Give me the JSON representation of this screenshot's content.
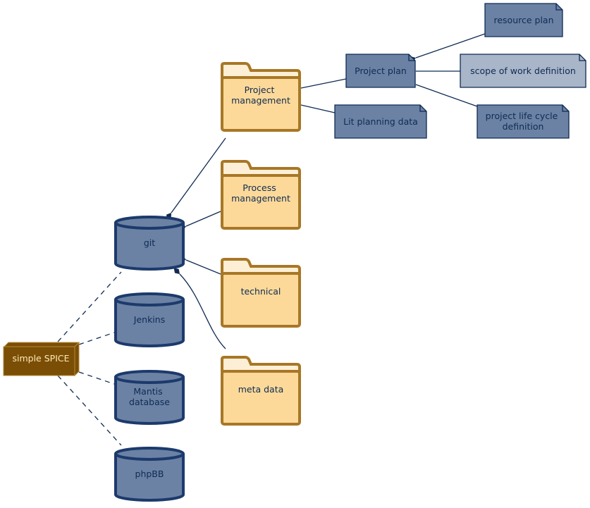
{
  "colors": {
    "line": "#0f2b52",
    "db_fill": "#6b82a5",
    "db_stroke": "#1c3a6b",
    "folder_fill": "#fcd999",
    "folder_tab_fill": "#fdefd5",
    "folder_stroke": "#a87726",
    "note_fill": "#6b82a5",
    "note_light_fill": "#a9b5c8",
    "note_stroke": "#0f2b52",
    "node_fill": "#7a4e04",
    "node_stroke": "#b58a3a",
    "node_text": "#fde9b8"
  },
  "nodes": {
    "simple_spice": {
      "label": "simple SPICE"
    },
    "git": {
      "label": "git"
    },
    "jenkins": {
      "label": "Jenkins"
    },
    "mantis": {
      "label": [
        "Mantis",
        "database"
      ]
    },
    "phpbb": {
      "label": "phpBB"
    },
    "project_management": {
      "label": [
        "Project",
        "management"
      ]
    },
    "process_management": {
      "label": [
        "Process",
        "management"
      ]
    },
    "technical": {
      "label": "technical"
    },
    "meta_data": {
      "label": "meta data"
    },
    "project_plan": {
      "label": "Project plan"
    },
    "lit_planning_data": {
      "label": "Lit planning data"
    },
    "resource_plan": {
      "label": "resource plan"
    },
    "scope_of_work": {
      "label": "scope of work definition"
    },
    "project_life_cycle": {
      "label": [
        "project life cycle",
        "definition"
      ]
    }
  }
}
